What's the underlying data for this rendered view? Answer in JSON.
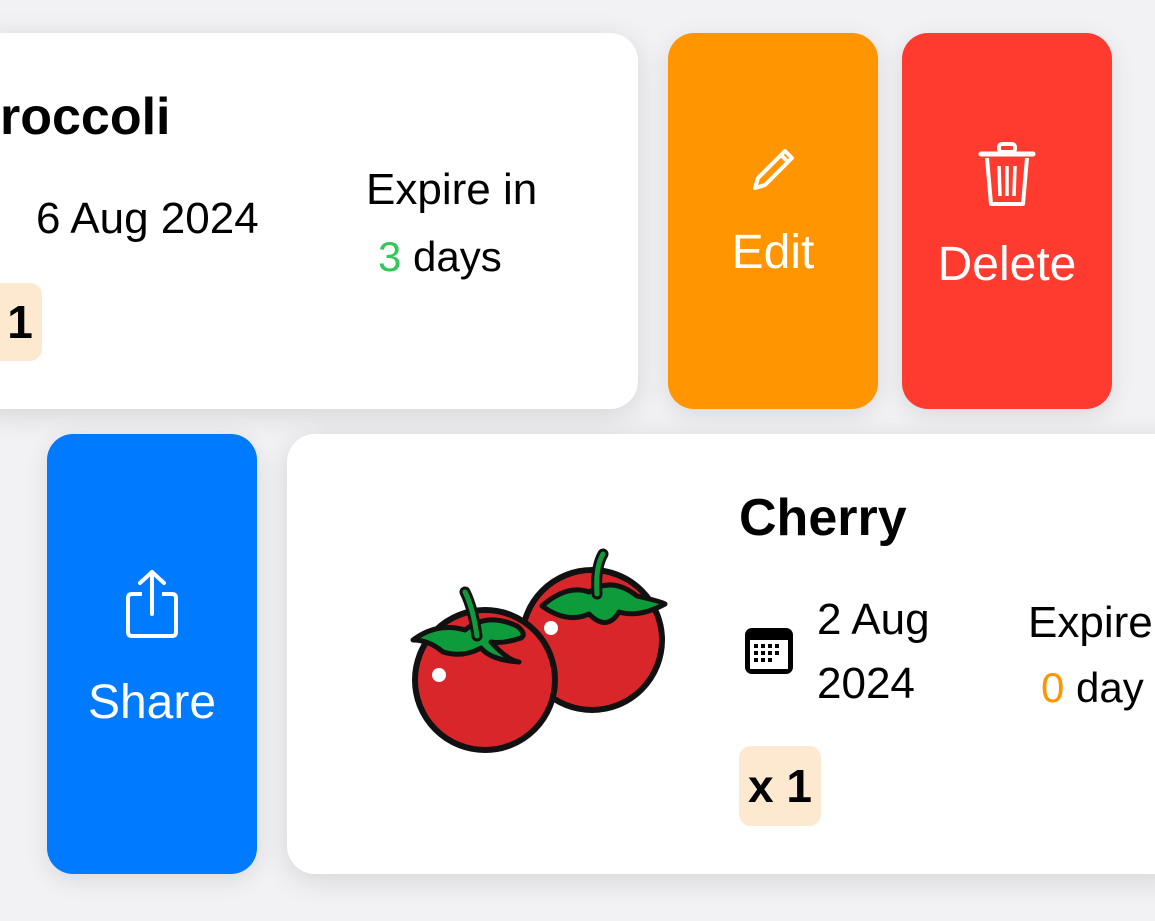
{
  "items": [
    {
      "title": "roccoli",
      "date": "6 Aug 2024",
      "expire_label": "Expire in",
      "expire_value": "3",
      "days_label": "days",
      "quantity": "1",
      "expire_color": "#34c759"
    },
    {
      "title": "Cherry",
      "date_line1": "2 Aug",
      "date_line2": "2024",
      "expire_label": "Expire",
      "expire_value": "0",
      "days_label": "day",
      "quantity": "x 1",
      "expire_color": "#ff9500",
      "image_icon": "cherry-tomato-icon"
    }
  ],
  "actions": {
    "edit_label": "Edit",
    "delete_label": "Delete",
    "share_label": "Share"
  },
  "colors": {
    "edit": "#ff9500",
    "delete": "#ff3b30",
    "share": "#007aff",
    "quantity_badge": "#fde9cf"
  },
  "icons": {
    "edit": "pencil-icon",
    "delete": "trash-icon",
    "share": "share-icon",
    "calendar": "calendar-icon"
  }
}
